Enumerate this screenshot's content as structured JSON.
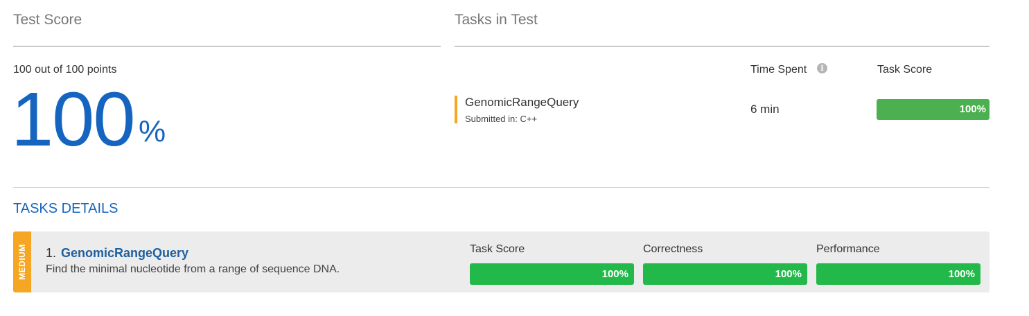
{
  "test_score": {
    "title": "Test Score",
    "points_text": "100 out of 100 points",
    "percent_value": "100",
    "percent_sign": "%"
  },
  "tasks_in_test": {
    "title": "Tasks in Test",
    "columns": {
      "time_spent": "Time Spent",
      "task_score": "Task Score"
    },
    "info_icon": "info-icon",
    "tasks": [
      {
        "name": "GenomicRangeQuery",
        "submitted": "Submitted in: C++",
        "time": "6 min",
        "score_label": "100%",
        "score_fraction": 1.0,
        "marker_color": "#f5a623",
        "bar_color": "#4caf50"
      }
    ]
  },
  "tasks_details": {
    "title": "TASKS DETAILS",
    "items": [
      {
        "difficulty": "MEDIUM",
        "difficulty_color": "#f5a623",
        "index": "1.",
        "name": "GenomicRangeQuery",
        "description": "Find the minimal nucleotide from a range of sequence DNA.",
        "metrics": [
          {
            "label": "Task Score",
            "value": "100%",
            "fraction": 1.0
          },
          {
            "label": "Correctness",
            "value": "100%",
            "fraction": 1.0
          },
          {
            "label": "Performance",
            "value": "100%",
            "fraction": 1.0
          }
        ],
        "bar_color": "#23b94a"
      }
    ]
  },
  "colors": {
    "accent_blue": "#1565c0",
    "link_blue": "#1e5f9e"
  }
}
